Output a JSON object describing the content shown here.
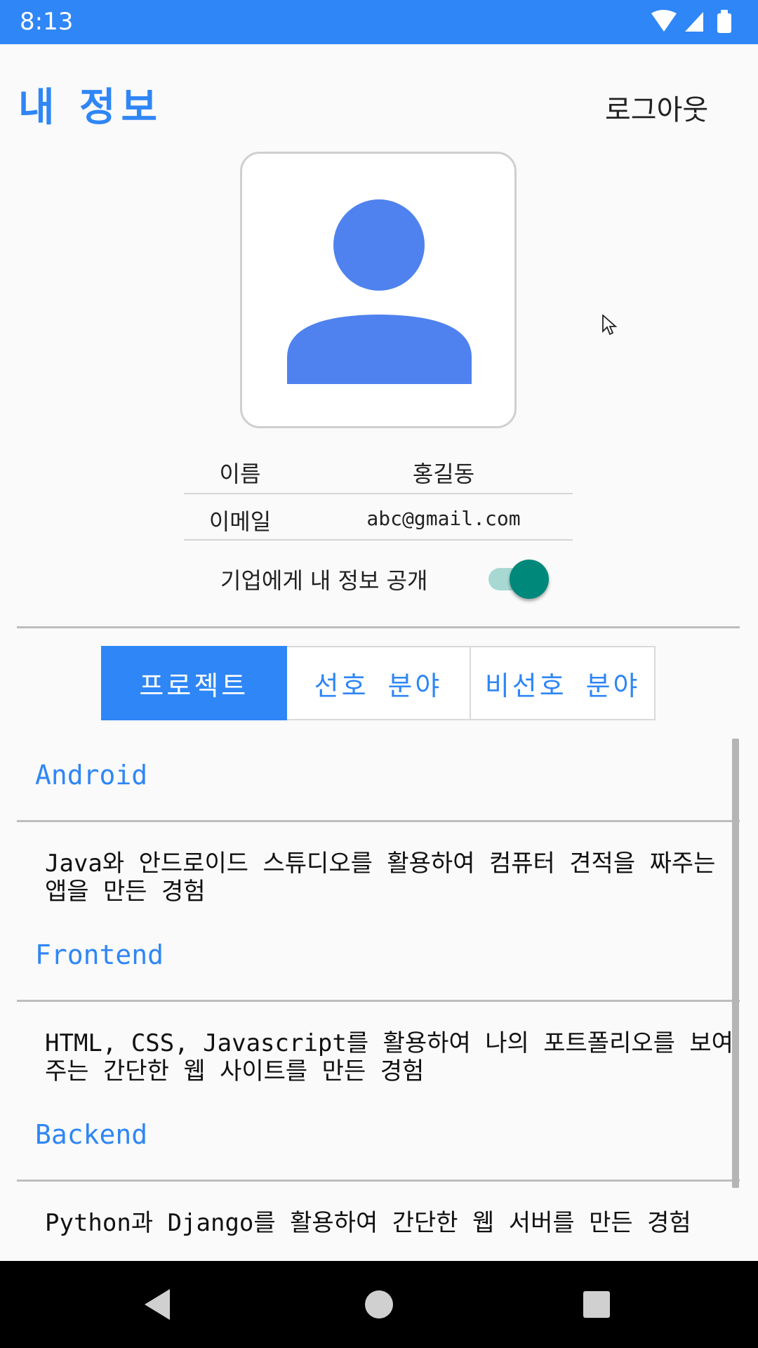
{
  "status_bar": {
    "time": "8:13",
    "color": "#2f86f6",
    "icons": [
      "wifi-icon",
      "signal-icon",
      "battery-icon"
    ]
  },
  "header": {
    "title": "내 정보",
    "logout_label": "로그아웃"
  },
  "profile": {
    "avatar_icon": "person-icon",
    "name_label": "이름",
    "name_value": "홍길동",
    "email_label": "이메일",
    "email_value": "abc@gmail.com",
    "share_label": "기업에게 내 정보 공개",
    "share_enabled": true
  },
  "tabs": [
    {
      "label": "프로젝트",
      "active": true
    },
    {
      "label": "선호 분야",
      "active": false
    },
    {
      "label": "비선호 분야",
      "active": false
    }
  ],
  "projects": [
    {
      "title": "Android",
      "description": "Java와 안드로이드 스튜디오를 활용하여 컴퓨터 견적을 짜주는 앱을 만든 경험"
    },
    {
      "title": "Frontend",
      "description": " HTML, CSS, Javascript를 활용하여 나의 포트폴리오를 보여주는 간단한 웹 사이트를 만든 경험"
    },
    {
      "title": "Backend",
      "description": " Python과 Django를 활용하여 간단한 웹 서버를 만든 경험"
    }
  ],
  "nav_bar": {
    "icons": [
      "back-icon",
      "home-icon",
      "recents-icon"
    ]
  },
  "colors": {
    "accent": "#2f86f6",
    "toggle_on": "#00897b",
    "background": "#fafafa"
  }
}
